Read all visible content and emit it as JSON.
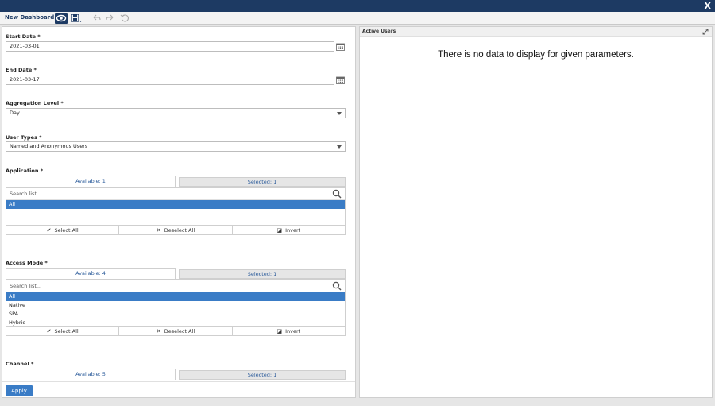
{
  "window": {
    "close_label": "X"
  },
  "toolbar": {
    "dashboard_title": "New Dashboard",
    "icons": [
      "eye-icon",
      "save-icon",
      "undo-icon",
      "redo-icon",
      "reset-icon"
    ]
  },
  "filters": {
    "start_date": {
      "label": "Start Date *",
      "value": "2021-03-01"
    },
    "end_date": {
      "label": "End Date *",
      "value": "2021-03-17"
    },
    "aggregation_level": {
      "label": "Aggregation Level *",
      "value": "Day"
    },
    "user_types": {
      "label": "User Types *",
      "value": "Named and Anonymous Users"
    },
    "application": {
      "label": "Application *",
      "available_tab": "Available: 1",
      "selected_tab": "Selected: 1",
      "search_placeholder": "Search list...",
      "items": [
        "All"
      ]
    },
    "access_mode": {
      "label": "Access Mode *",
      "available_tab": "Available: 4",
      "selected_tab": "Selected: 1",
      "search_placeholder": "Search list...",
      "items": [
        "All",
        "Native",
        "SPA",
        "Hybrid"
      ]
    },
    "channel": {
      "label": "Channel *",
      "available_tab": "Available: 5",
      "selected_tab": "Selected: 1"
    },
    "actions": {
      "select_all": "Select All",
      "deselect_all": "Deselect All",
      "invert": "Invert"
    },
    "apply_label": "Apply"
  },
  "widget": {
    "title": "Active Users",
    "message": "There is no data to display for given parameters."
  },
  "colors": {
    "header": "#1d3a63",
    "accent": "#3a7cc6"
  }
}
